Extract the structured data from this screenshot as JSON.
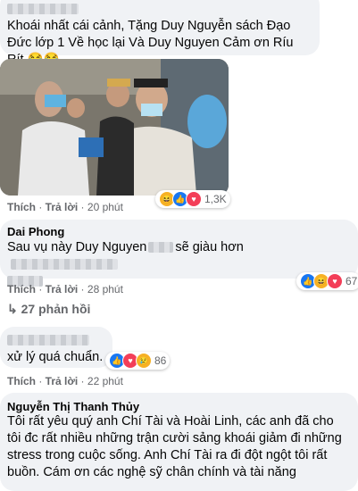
{
  "comments": [
    {
      "text": "Khoái nhất cái cảnh, Tặng Duy Nguyễn sách Đạo Đức lớp 1 Về học lại Và Duy Nguyen Cảm ơn Ríu Rít 😂😂",
      "reactions": [
        "haha",
        "like",
        "love"
      ],
      "reaction_count": "1,3K",
      "action_like": "Thích",
      "action_reply": "Trả lời",
      "time": "20 phút"
    },
    {
      "author": "Dai Phong",
      "text_a": "Sau vụ này Duy Nguyen",
      "text_b": "sẽ giàu hơn",
      "reactions": [
        "like",
        "haha",
        "love"
      ],
      "reaction_count": "67",
      "action_like": "Thích",
      "action_reply": "Trả lời",
      "time": "28 phút",
      "replies_label": "27 phản hồi"
    },
    {
      "text": "xử lý quá chuẩn.",
      "reactions": [
        "like",
        "love",
        "sad"
      ],
      "reaction_count": "86",
      "action_like": "Thích",
      "action_reply": "Trả lời",
      "time": "22 phút"
    },
    {
      "author": "Nguyễn Thị Thanh Thủy",
      "text": "Tôi rất yêu quý anh Chí Tài và Hoài Linh, các anh đã cho tôi đc rất nhiều những trận cười sảng khoái giảm đi những stress trong cuộc sống. Anh Chí Tài ra đi đột ngột tôi rất buồn. Cám ơn các nghệ sỹ chân chính và tài năng"
    }
  ],
  "colors": {
    "bubble": "#f0f2f5",
    "meta": "#65676b",
    "like": "#1877f2",
    "love": "#f33e58",
    "haha": "#f7b125"
  }
}
